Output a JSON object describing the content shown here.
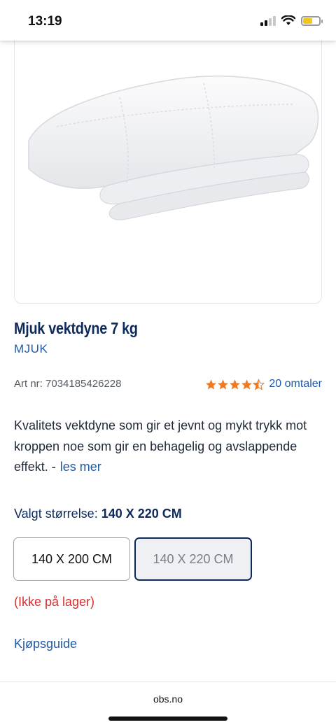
{
  "status": {
    "time": "13:19"
  },
  "product": {
    "title": "Mjuk vektdyne 7 kg",
    "brand": "MJUK",
    "art_nr": "Art nr: 7034185426228",
    "rating": 4.5,
    "reviews": "20 omtaler",
    "description": "Kvalitets vektdyne som gir et jevnt og mykt trykk mot kroppen noe som gir en behagelig og avslappende effekt. -",
    "read_more": "les mer"
  },
  "size": {
    "label": "Valgt størrelse:",
    "selected": "140 X 220 CM",
    "options": [
      "140 X 200 CM",
      "140 X 220 CM"
    ]
  },
  "stock_status": "(Ikke på lager)",
  "guide_link": "Kjøpsguide",
  "browser": {
    "url": "obs.no"
  },
  "colors": {
    "navy": "#0c2a5b",
    "link": "#1f5aa6",
    "star": "#f07a22",
    "error": "#d32f2f"
  }
}
